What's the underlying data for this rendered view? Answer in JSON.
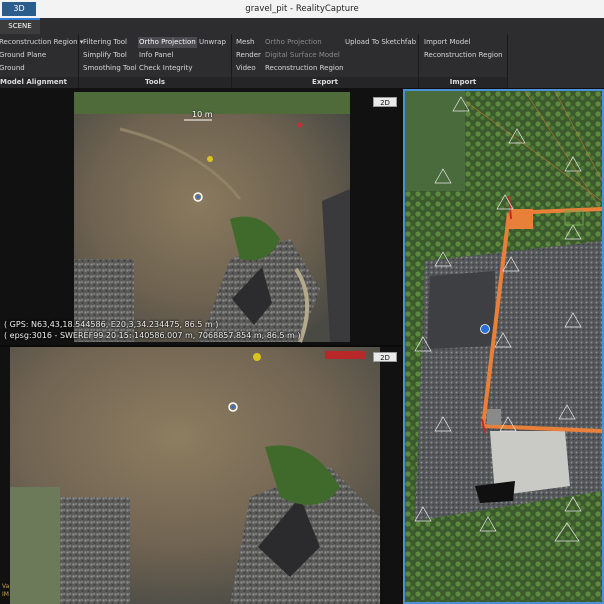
{
  "window": {
    "tab_label": "3D",
    "title": "gravel_pit - RealityCapture"
  },
  "ribbon_tab": "SCENE",
  "groups": {
    "alignment": {
      "label": "Model Alignment",
      "items": [
        "Reconstruction Region ▾",
        "Ground Plane",
        "Ground"
      ]
    },
    "tools": {
      "label": "Tools",
      "col1": [
        "Filtering Tool",
        "Simplify Tool",
        "Smoothing Tool"
      ],
      "col2": [
        "Ortho Projection",
        "Info Panel",
        "Check Integrity"
      ],
      "unwrap": "Unwrap"
    },
    "export": {
      "label": "Export",
      "col1": [
        "Mesh",
        "Render",
        "Video"
      ],
      "col2": [
        "Ortho Projection",
        "Digital Surface Model",
        "Reconstruction Region"
      ],
      "sketchfab": "Upload To Sketchfab"
    },
    "import": {
      "label": "Import",
      "items": [
        "Import Model",
        "Reconstruction Region"
      ]
    }
  },
  "views": {
    "top": {
      "badge": "2D",
      "scale": "10 m",
      "gps": "( GPS: N63,43,18.544586, E20,3,34.234475, 86.5 m )",
      "epsg": "( epsg:3016 - SWEREF99 20 15: 140586.007 m, 7068857.854 m, 86.5 m )"
    },
    "bottom": {
      "badge": "2D",
      "corner_text": [
        "Va",
        "IM"
      ]
    }
  },
  "colors": {
    "accent": "#2e7bd6",
    "selection_frame": "#4a90d9",
    "region": "#e8803a"
  }
}
